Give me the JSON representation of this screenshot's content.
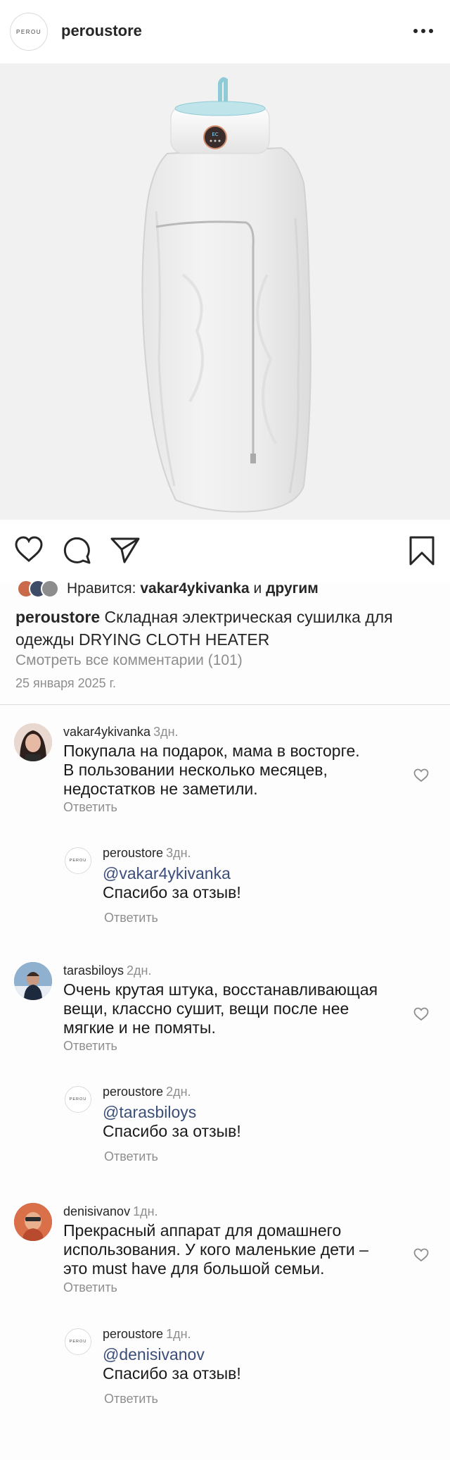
{
  "header": {
    "logo_text": "PEROU",
    "username": "peroustore"
  },
  "post": {
    "likes_prefix": "Нравится:",
    "likes_user": "vakar4ykivanka",
    "likes_and": "и",
    "likes_others": "другим",
    "caption_user": "peroustore",
    "caption_text": "Складная электрическая сушилка для одежды DRYING CLOTH HEATER",
    "view_all": "Смотреть все комментарии (101)",
    "date": "25 января 2025 г.",
    "device_display": "EC"
  },
  "comments": [
    {
      "user": "vakar4ykivanka",
      "time": "3дн.",
      "lines": [
        "Покупала на подарок, мама в восторге.",
        "В пользовании несколько месяцев,",
        "недостатков не заметили."
      ],
      "reply_label": "Ответить",
      "answer": {
        "user": "peroustore",
        "time": "3дн.",
        "mention": "@vakar4ykivanka",
        "text": "Спасибо за отзыв!",
        "reply_label": "Ответить"
      }
    },
    {
      "user": "tarasbiloys",
      "time": "2дн.",
      "lines": [
        "Очень крутая штука, восстанавливающая",
        "вещи, классно сушит, вещи после нее",
        "мягкие и не помяты."
      ],
      "reply_label": "Ответить",
      "answer": {
        "user": "peroustore",
        "time": "2дн.",
        "mention": "@tarasbiloys",
        "text": "Спасибо за отзыв!",
        "reply_label": "Ответить"
      }
    },
    {
      "user": "denisivanov",
      "time": "1дн.",
      "lines": [
        "Прекрасный аппарат для домашнего",
        "использования. У кого маленькие дети –",
        "это must have для большой семьи."
      ],
      "reply_label": "Ответить",
      "answer": {
        "user": "peroustore",
        "time": "1дн.",
        "mention": "@denisivanov",
        "text": "Спасибо за отзыв!",
        "reply_label": "Ответить"
      }
    }
  ],
  "icons": {
    "more": "more-horizontal-icon",
    "like": "heart-icon",
    "comment": "comment-bubble-icon",
    "share": "paper-plane-icon",
    "save": "bookmark-icon",
    "comment_like": "heart-small-icon"
  },
  "colors": {
    "text": "#262626",
    "muted": "#8e8e8e",
    "mention": "#3b4e7a",
    "divider": "#dbdbdb",
    "device_accent": "#7fc7d3"
  }
}
